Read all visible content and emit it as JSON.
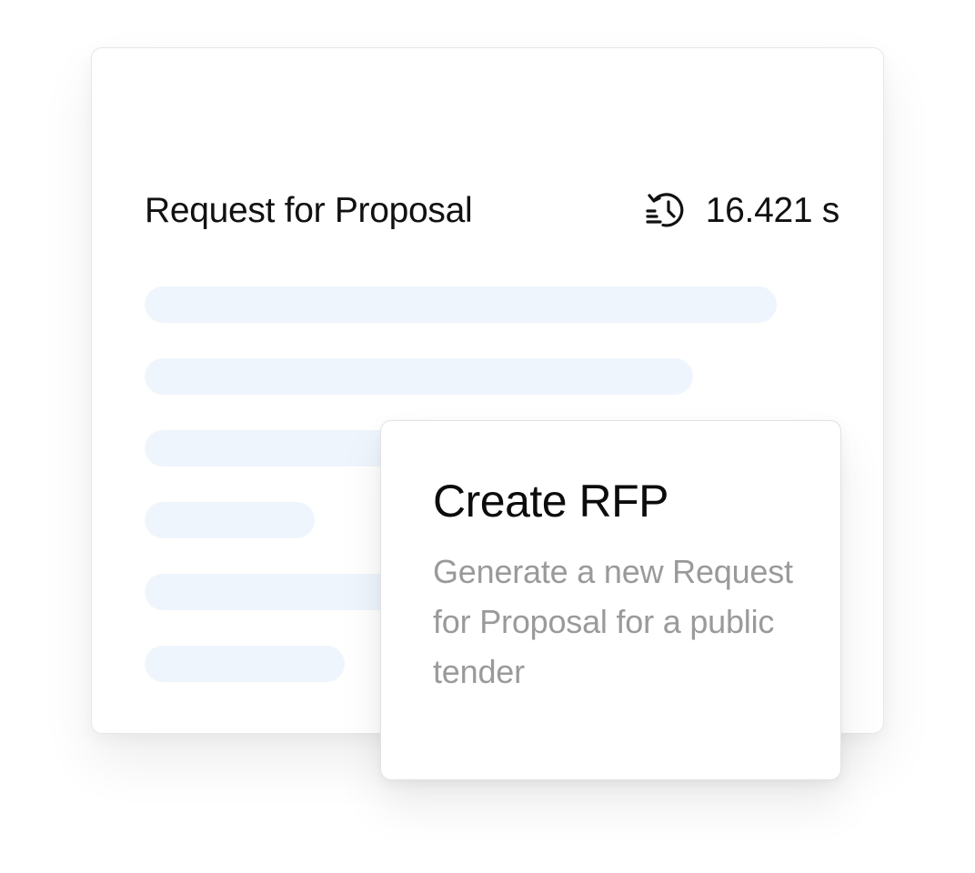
{
  "document": {
    "title": "Request for Proposal",
    "timer": {
      "icon": "clock-history-icon",
      "value": "16.421 s"
    }
  },
  "popup": {
    "title": "Create RFP",
    "description": "Generate a new Request for Proposal for a public tender"
  },
  "colors": {
    "skeleton": "#eff5fd",
    "text_primary": "#111111",
    "text_secondary": "#9a9a9a"
  }
}
